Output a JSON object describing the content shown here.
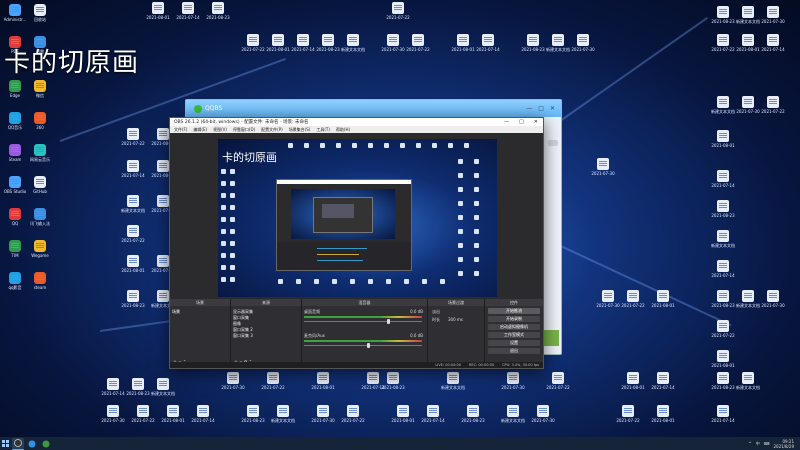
{
  "desktop": {
    "title_text": "卡的切原画",
    "left_icons": [
      "Administr...",
      "回收站",
      "PDF",
      "迅雷",
      "Edge",
      "微信",
      "QQ音乐",
      "360",
      "Steam",
      "网易云音乐",
      "OBS Studio",
      "GitHub",
      "QQ",
      "讯飞输入法",
      "TIM",
      "Wegame",
      "qq影音",
      "steam"
    ],
    "labels": [
      "2021-07-22",
      "2021-08-01",
      "2021-07-14",
      "2021-08-23",
      "新建文本文档",
      "2021-07-30"
    ]
  },
  "qq_window": {
    "title": "QQBS",
    "controls": [
      "—",
      "□",
      "✕"
    ]
  },
  "obs": {
    "title": "OBS 26.1.2 (64-bit, windows) - 配置文件: 未命名 - 场景: 未命名",
    "title_controls": [
      "—",
      "□",
      "✕"
    ],
    "menu": [
      "文件(F)",
      "编辑(E)",
      "视图(V)",
      "停靠窗口(D)",
      "配置文件(P)",
      "场景集合(S)",
      "工具(T)",
      "帮助(H)"
    ],
    "preview_title": "卡的切原画",
    "panels": {
      "scene_header": "场景",
      "scenes": [
        "场景"
      ],
      "source_header": "来源",
      "sources": [
        "显示器采集",
        "窗口采集",
        "图像",
        "窗口采集 2",
        "窗口采集 3"
      ],
      "audio_header": "混音器",
      "audio_tracks": [
        {
          "name": "桌面音频",
          "db": "0.0 dB",
          "level": 0.72
        },
        {
          "name": "麦克风/Aux",
          "db": "0.0 dB",
          "level": 0.55
        }
      ],
      "transition_header": "场景过渡",
      "transition_name": "淡出",
      "transition_duration_label": "时长",
      "transition_duration": "300 ms",
      "controls_header": "控件",
      "controls": [
        "开始推流",
        "开始录制",
        "启动虚拟摄像机",
        "工作室模式",
        "设置",
        "退出"
      ]
    },
    "status_bar": [
      "LIVE: 00:00:00",
      "REC: 00:00:00",
      "CPU: 3.4%, 30.00 fps"
    ]
  },
  "taskbar": {
    "clock_time": "09:21",
    "clock_date": "2021/8/29",
    "tray": [
      "^",
      "中",
      "⌨"
    ]
  },
  "colors": {
    "accent": "#3ea13e",
    "obs_bg": "#2b2b2e",
    "desktop_bg": "#0b2563"
  }
}
